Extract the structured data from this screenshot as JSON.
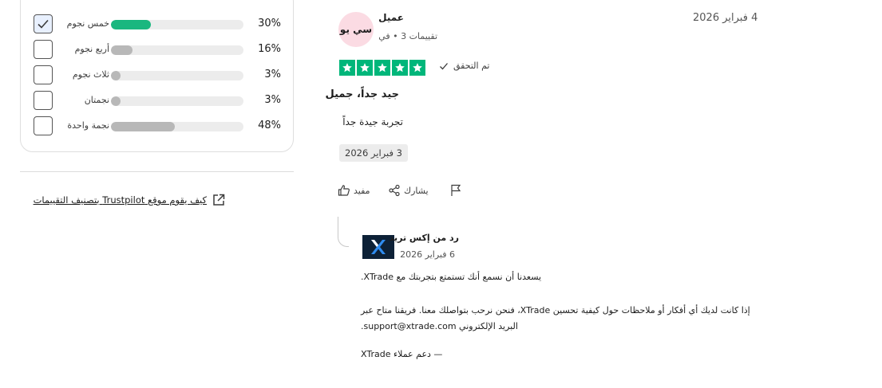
{
  "rating_filter": {
    "rows": [
      {
        "label": "خمس نجوم",
        "percent_text": "30%",
        "percent": 30,
        "checked": true,
        "color": "#1ab77f"
      },
      {
        "label": "أربع نجوم",
        "percent_text": "16%",
        "percent": 16,
        "checked": false,
        "color": "#b8b8b8"
      },
      {
        "label": "ثلاث نجوم",
        "percent_text": "3%",
        "percent": 3,
        "checked": false,
        "color": "#b8b8b8"
      },
      {
        "label": "نجمتان",
        "percent_text": "3%",
        "percent": 3,
        "checked": false,
        "color": "#b8b8b8"
      },
      {
        "label": "نجمة واحدة",
        "percent_text": "48%",
        "percent": 48,
        "checked": false,
        "color": "#b8b8b8"
      }
    ]
  },
  "trustpilot_link": {
    "label": "كيف يقوم موقع Trustpilot بتصنيف التقييمات",
    "icon": "external-link-icon"
  },
  "review": {
    "date": "4 فبراير 2026",
    "avatar_initials": "سي يو",
    "avatar_color": "#fbdbe3",
    "reviewer_name": "عميل",
    "reviewer_meta": "تقييمات 3 • في",
    "rating": 5,
    "star_color": "#00b67a",
    "verified_label": "تم التحقق",
    "title": "جيد جداً، جميل",
    "body": "تجربة جيدة جداً",
    "experience_date": "3 فبراير 2026",
    "actions": {
      "useful": "مفيد",
      "share": "يشارك",
      "report_icon": "flag-icon"
    }
  },
  "reply": {
    "from": "رد من إكس تريد",
    "date": "6 فبراير 2026",
    "logo_color": "#0d2137",
    "paragraph1": "يسعدنا أن نسمع أنك تستمتع بتجربتك مع XTrade.",
    "paragraph2_line1": "إذا كانت لديك أي أفكار أو ملاحظات حول كيفية تحسين XTrade، فنحن نرحب بتواصلك معنا. فريقنا متاح عبر",
    "paragraph2_line2": "البريد الإلكتروني support@xtrade.com.",
    "signature": "— دعم عملاء XTrade"
  }
}
